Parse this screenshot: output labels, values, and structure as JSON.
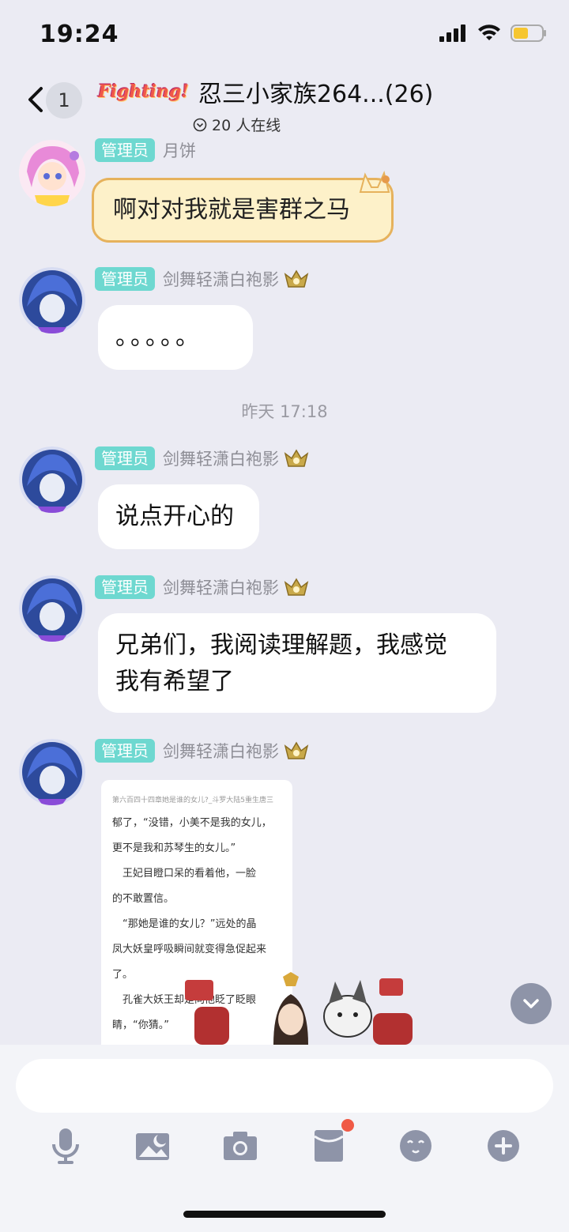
{
  "status": {
    "time": "19:24"
  },
  "nav": {
    "unread": "1",
    "game_logo_text": "Fighting!",
    "title": "忍三小家族264...(26)",
    "online": "20 人在线"
  },
  "messages": [
    {
      "tag": "管理员",
      "sender": "月饼",
      "text": "啊对对我就是害群之马"
    },
    {
      "tag": "管理员",
      "sender": "剑舞轻潇白袍影",
      "text": "。。。。。"
    },
    {
      "tag": "管理员",
      "sender": "剑舞轻潇白袍影",
      "text": "说点开心的"
    },
    {
      "tag": "管理员",
      "sender": "剑舞轻潇白袍影",
      "text_line1": "兄弟们，我阅读理解题，我感觉",
      "text_line2": "我有希望了"
    },
    {
      "tag": "管理员",
      "sender": "剑舞轻潇白袍影"
    }
  ],
  "timestamp": "昨天 17:18",
  "image_content": {
    "header": "第六百四十四章她是谁的女儿?_斗罗大陆5重生唐三",
    "lines": [
      "郁了，“没错，小美不是我的女儿，",
      "更不是我和苏琴生的女儿。”",
      "　王妃目瞪口呆的看着他，一脸",
      "的不敢置信。",
      "　“那她是谁的女儿？”远处的晶",
      "凤大妖皇呼吸瞬间就变得急促起来",
      "了。",
      "　孔雀大妖王却是向他眨了眨眼",
      "睛，“你猜。”"
    ]
  },
  "colors": {
    "admin_tag": "#6ed8d0",
    "background": "#ebebf3",
    "accent_dot": "#f05a46"
  },
  "toolbar_icons": [
    "microphone-icon",
    "image-icon",
    "camera-icon",
    "red-packet-icon",
    "emoji-icon",
    "plus-icon"
  ]
}
